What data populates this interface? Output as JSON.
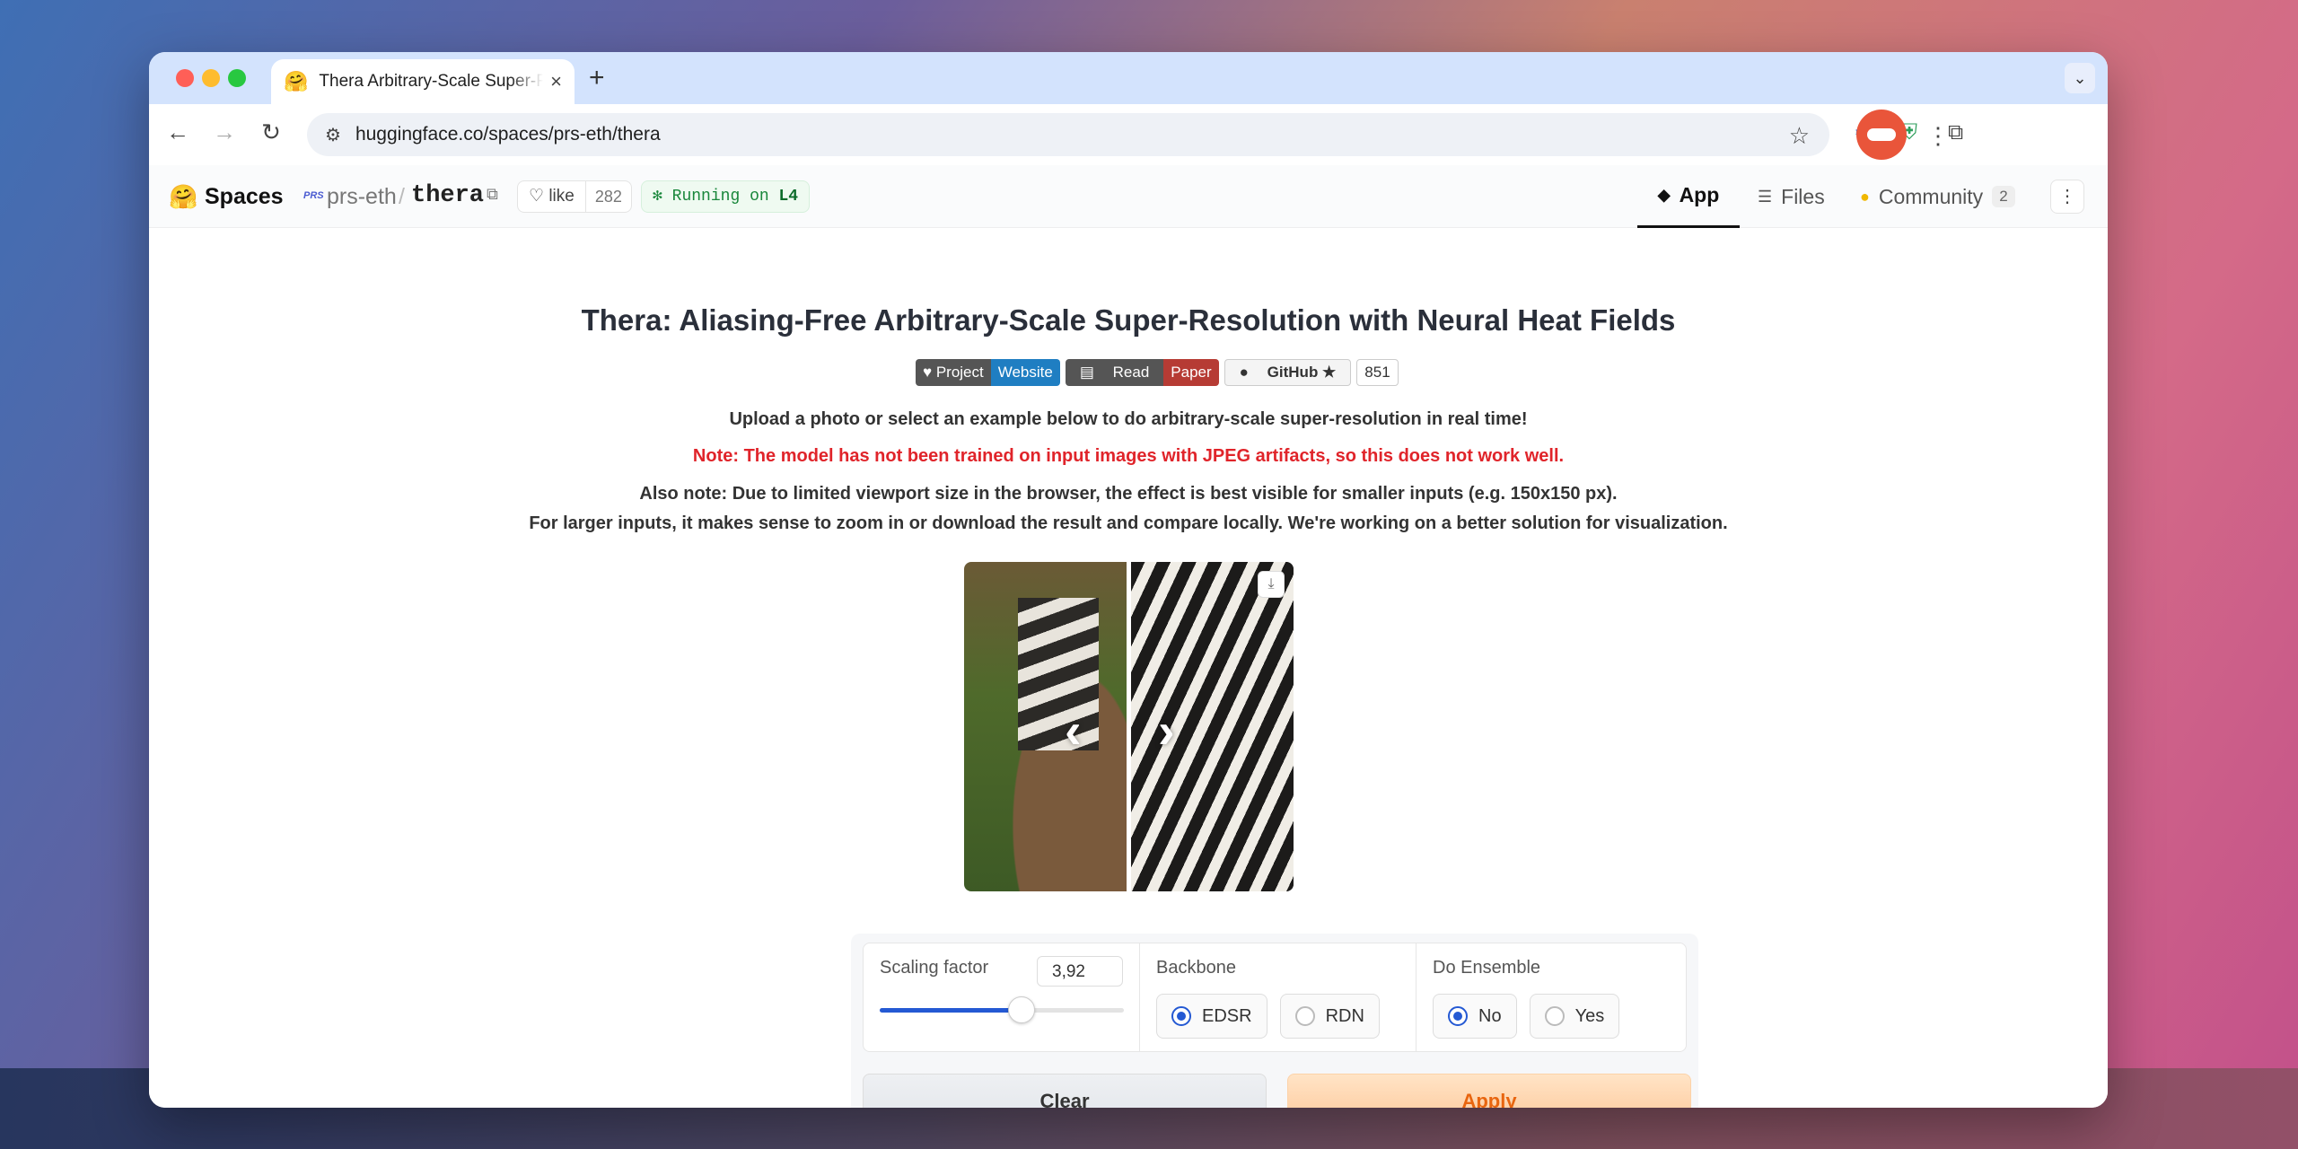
{
  "browser": {
    "tab_title": "Thera Arbitrary-Scale Super-R",
    "tab_favicon": "🤗",
    "url": "huggingface.co/spaces/prs-eth/thera"
  },
  "hf": {
    "spaces_label": "Spaces",
    "org_badge": "PRS",
    "org": "prs-eth",
    "repo": "thera",
    "like_label": "like",
    "like_count": "282",
    "running_prefix": "Running on",
    "running_hw": "L4",
    "tabs": [
      {
        "label": "App"
      },
      {
        "label": "Files"
      },
      {
        "label": "Community",
        "count": "2"
      }
    ]
  },
  "page": {
    "title": "Thera: Aliasing-Free Arbitrary-Scale Super-Resolution with Neural Heat Fields",
    "badges": {
      "project_a": "♥ Project",
      "project_b": "Website",
      "read_a": "Read",
      "read_b": "Paper",
      "github": "GitHub ★",
      "github_count": "851"
    },
    "intro": "Upload a photo or select an example below to do arbitrary-scale super-resolution in real time!",
    "note": "Note: The model has not been trained on input images with JPEG artifacts, so this does not work well.",
    "also_note_1": "Also note: Due to limited viewport size in the browser, the effect is best visible for smaller inputs (e.g. 150x150 px).",
    "also_note_2": "For larger inputs, it makes sense to zoom in or download the result and compare locally. We're working on a better solution for visualization."
  },
  "controls": {
    "scaling_label": "Scaling factor",
    "scaling_value": "3,92",
    "scaling_fraction": 0.58,
    "backbone_label": "Backbone",
    "backbone_options": [
      "EDSR",
      "RDN"
    ],
    "backbone_selected": "EDSR",
    "ensemble_label": "Do Ensemble",
    "ensemble_options": [
      "No",
      "Yes"
    ],
    "ensemble_selected": "No",
    "clear_label": "Clear",
    "apply_label": "Apply"
  }
}
